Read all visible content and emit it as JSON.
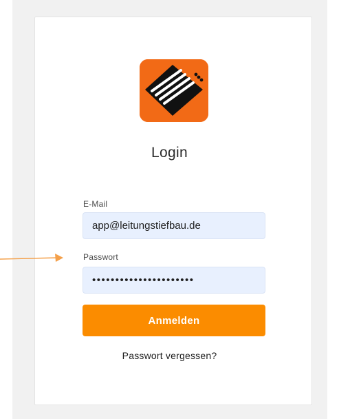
{
  "login": {
    "logo": "company-logo",
    "title": "Login",
    "email_label": "E-Mail",
    "email_value": "app@leitungstiefbau.de",
    "password_label": "Passwort",
    "password_value": "••••••••••••••••••••••",
    "submit_label": "Anmelden",
    "forgot_label": "Passwort vergessen?"
  },
  "annotation": {
    "arrow": "arrow-icon"
  },
  "colors": {
    "brand_orange": "#f26a16",
    "button_orange": "#fb8c00",
    "input_bg": "#e8f0fe",
    "annotation_arrow": "#f4a04a"
  }
}
